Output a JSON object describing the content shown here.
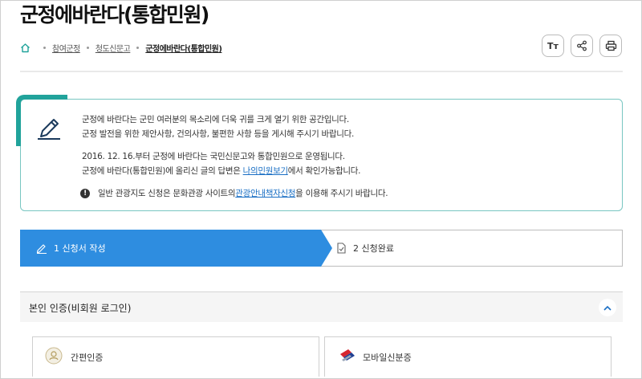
{
  "page": {
    "title": "군정에바란다(통합민원)"
  },
  "breadcrumb": {
    "items": [
      "참여군정",
      "청도신문고",
      "군정에바란다(통합민원)"
    ]
  },
  "tools": {
    "font_size_label": "Tт"
  },
  "notice": {
    "line1": "군정에 바란다는 군민 여러분의 목소리에 더욱 귀를 크게 열기 위한 공간입니다.",
    "line2": "군정 발전을 위한 제안사항, 건의사항, 불편한 사항 등을 게시해 주시기 바랍니다.",
    "line3": "2016. 12. 16.부터 군정에 바란다는 국민신문고와 통합민원으로 운영됩니다.",
    "line4_pre": "군정에 바란다(통합민원)에 올리신 글의 답변은 ",
    "line4_link": "나의민원보기",
    "line4_post": "에서 확인가능합니다.",
    "info_icon": "!",
    "info_pre": "일반 관광지도 신청은 문화관광 사이트의 ",
    "info_link": "관광안내책자신청",
    "info_post": "을 이용해 주시기 바랍니다."
  },
  "steps": [
    {
      "label": "1 신청서 작성",
      "active": true
    },
    {
      "label": "2 신청완료",
      "active": false
    }
  ],
  "identity": {
    "section_label": "본인 인증(비회원 로그인)",
    "options": [
      "간편인증",
      "모바일신분증"
    ]
  },
  "colors": {
    "accent": "#21a39b",
    "step_active": "#2e8de0",
    "link": "#1a6fc4"
  }
}
